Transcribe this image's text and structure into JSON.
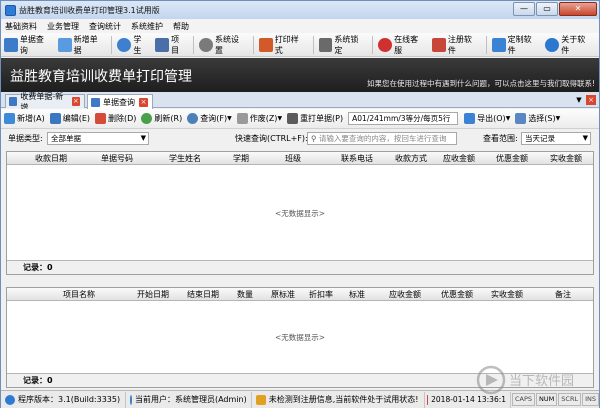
{
  "window": {
    "title": "益胜教育培训收费单打印管理3.1试用版",
    "controls": [
      "—",
      "▭",
      "✕"
    ]
  },
  "menu": [
    "基础资料",
    "业务管理",
    "查询统计",
    "系统维护",
    "帮助"
  ],
  "toolbar": [
    {
      "label": "单据查询",
      "icon": "search-doc-icon",
      "color": "#3d7cc9"
    },
    {
      "label": "新增单据",
      "icon": "new-doc-icon",
      "color": "#5a9be0"
    },
    {
      "label": "学生",
      "icon": "student-icon",
      "color": "#3c80cf"
    },
    {
      "label": "项目",
      "icon": "grid-icon",
      "color": "#4a6fa8"
    },
    {
      "label": "系统设置",
      "icon": "gear-icon",
      "color": "#7a7a7a"
    },
    {
      "label": "打印样式",
      "icon": "print-style-icon",
      "color": "#d25a2a"
    },
    {
      "label": "系统锁定",
      "icon": "lock-icon",
      "color": "#6a6a6a"
    },
    {
      "label": "在线客服",
      "icon": "service-icon",
      "color": "#d03030"
    },
    {
      "label": "注册软件",
      "icon": "register-icon",
      "color": "#c8453a"
    },
    {
      "label": "定制软件",
      "icon": "custom-icon",
      "color": "#3a82d4"
    },
    {
      "label": "关于软件",
      "icon": "info-icon",
      "color": "#2b78d0"
    }
  ],
  "banner": {
    "title": "益胜教育培训收费单打印管理",
    "hint": "如果您在使用过程中有遇到什么问题，可以点击这里与我们取得联系!"
  },
  "tabs": [
    {
      "label": "收费单据-新增",
      "active": false
    },
    {
      "label": "单据查询",
      "active": true
    }
  ],
  "actions": {
    "new": "新增(A)",
    "edit": "编辑(E)",
    "delete": "删除(D)",
    "refresh": "刷新(R)",
    "query": "查询(F)",
    "void": "作废(Z)",
    "reprint": "重打单据(P)",
    "paper": "A01/241mm/3等分/每页5行",
    "export": "导出(O)",
    "options": "选择(S)"
  },
  "filter": {
    "type_label": "单据类型:",
    "type_value": "全部单据",
    "quick_label": "快速查询(CTRL+F):",
    "quick_placeholder": "请输入要查询的内容，按回车进行查询",
    "range_label": "查看范围:",
    "range_value": "当天记录"
  },
  "grid1": {
    "headers": [
      "收款日期",
      "单据号码",
      "学生姓名",
      "学期",
      "班级",
      "联系电话",
      "收款方式",
      "应收金额",
      "优惠金额",
      "实收金额"
    ],
    "empty": "<无数据显示>",
    "count": "记录：0"
  },
  "grid2": {
    "headers": [
      "项目名称",
      "开始日期",
      "结束日期",
      "数量",
      "原标准",
      "折扣率",
      "标准",
      "应收金额",
      "优惠金额",
      "实收金额",
      "备注"
    ],
    "empty": "<无数据显示>",
    "count": "记录：0"
  },
  "status": {
    "version": "程序版本：3.1(Build:3335)",
    "user": "当前用户：系统管理员(Admin)",
    "reg": "未检测到注册信息,当前软件处于试用状态!",
    "datetime": "2018-01-14 13:36:1",
    "keys": [
      "CAPS",
      "NUM",
      "SCRL",
      "INS"
    ]
  },
  "watermark": "当下软件园"
}
